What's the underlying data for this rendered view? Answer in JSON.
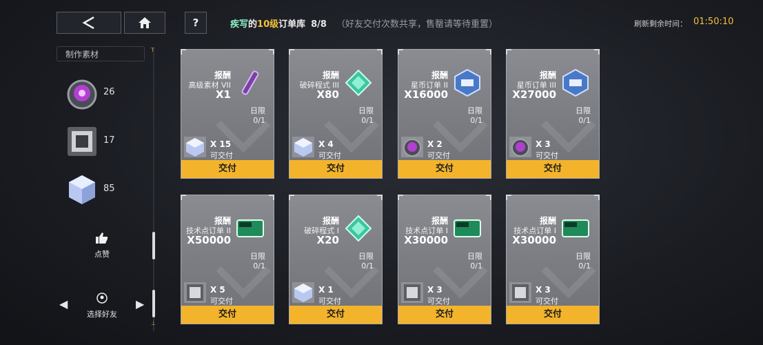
{
  "header": {
    "back_icon": "back-chevron-icon",
    "home_icon": "home-icon",
    "help_label": "?",
    "title_character": "疾写",
    "title_of": "的",
    "title_level": "10级",
    "title_suffix": "订单库",
    "title_count": "8/8",
    "title_hint": "（好友交付次数共享，售罄请等待重置）",
    "refresh_label": "刷新剩余时间：",
    "refresh_time": "01:50:10"
  },
  "sidebar": {
    "materials_header": "制作素材",
    "materials": [
      {
        "icon": "purple-core-icon",
        "count": "26"
      },
      {
        "icon": "tech-chip-icon",
        "count": "17"
      },
      {
        "icon": "crystal-cube-icon",
        "count": "85"
      }
    ],
    "like_label": "点赞",
    "select_friend_label": "选择好友",
    "scroll_top_mark": "T",
    "scroll_bottom_mark": "⊥"
  },
  "orders": [
    {
      "reward_label": "报酬",
      "reward_name": "高级素材 VII",
      "reward_qty": "X1",
      "reward_icon": "purple-vial-icon",
      "limit_label": "日限",
      "limit_value": "0/1",
      "req_icon": "crystal-cube-icon",
      "req_qty": "X 15",
      "req_label": "可交付",
      "button": "交付"
    },
    {
      "reward_label": "报酬",
      "reward_name": "破碎程式 III",
      "reward_qty": "X80",
      "reward_icon": "green-crystal-icon",
      "limit_label": "日限",
      "limit_value": "0/1",
      "req_icon": "crystal-cube-icon",
      "req_qty": "X 4",
      "req_label": "可交付",
      "button": "交付"
    },
    {
      "reward_label": "报酬",
      "reward_name": "星币订单 II",
      "reward_qty": "X16000",
      "reward_icon": "star-coin-icon",
      "limit_label": "日限",
      "limit_value": "0/1",
      "req_icon": "purple-core-icon",
      "req_qty": "X 2",
      "req_label": "可交付",
      "button": "交付"
    },
    {
      "reward_label": "报酬",
      "reward_name": "星币订单 III",
      "reward_qty": "X27000",
      "reward_icon": "star-coin-icon",
      "limit_label": "日限",
      "limit_value": "0/1",
      "req_icon": "purple-core-icon",
      "req_qty": "X 3",
      "req_label": "可交付",
      "button": "交付"
    },
    {
      "reward_label": "报酬",
      "reward_name": "技术点订单 II",
      "reward_qty": "X50000",
      "reward_icon": "exp-ticket-icon",
      "limit_label": "日限",
      "limit_value": "0/1",
      "req_icon": "tech-chip-icon",
      "req_qty": "X 5",
      "req_label": "可交付",
      "button": "交付"
    },
    {
      "reward_label": "报酬",
      "reward_name": "破碎程式 I",
      "reward_qty": "X20",
      "reward_icon": "green-crystal-icon",
      "limit_label": "日限",
      "limit_value": "0/1",
      "req_icon": "crystal-cube-icon",
      "req_qty": "X 1",
      "req_label": "可交付",
      "button": "交付"
    },
    {
      "reward_label": "报酬",
      "reward_name": "技术点订单 I",
      "reward_qty": "X30000",
      "reward_icon": "exp-ticket-icon",
      "limit_label": "日限",
      "limit_value": "0/1",
      "req_icon": "tech-chip-icon",
      "req_qty": "X 3",
      "req_label": "可交付",
      "button": "交付"
    },
    {
      "reward_label": "报酬",
      "reward_name": "技术点订单 I",
      "reward_qty": "X30000",
      "reward_icon": "exp-ticket-icon",
      "limit_label": "日限",
      "limit_value": "0/1",
      "req_icon": "tech-chip-icon",
      "req_qty": "X 3",
      "req_label": "可交付",
      "button": "交付"
    }
  ]
}
